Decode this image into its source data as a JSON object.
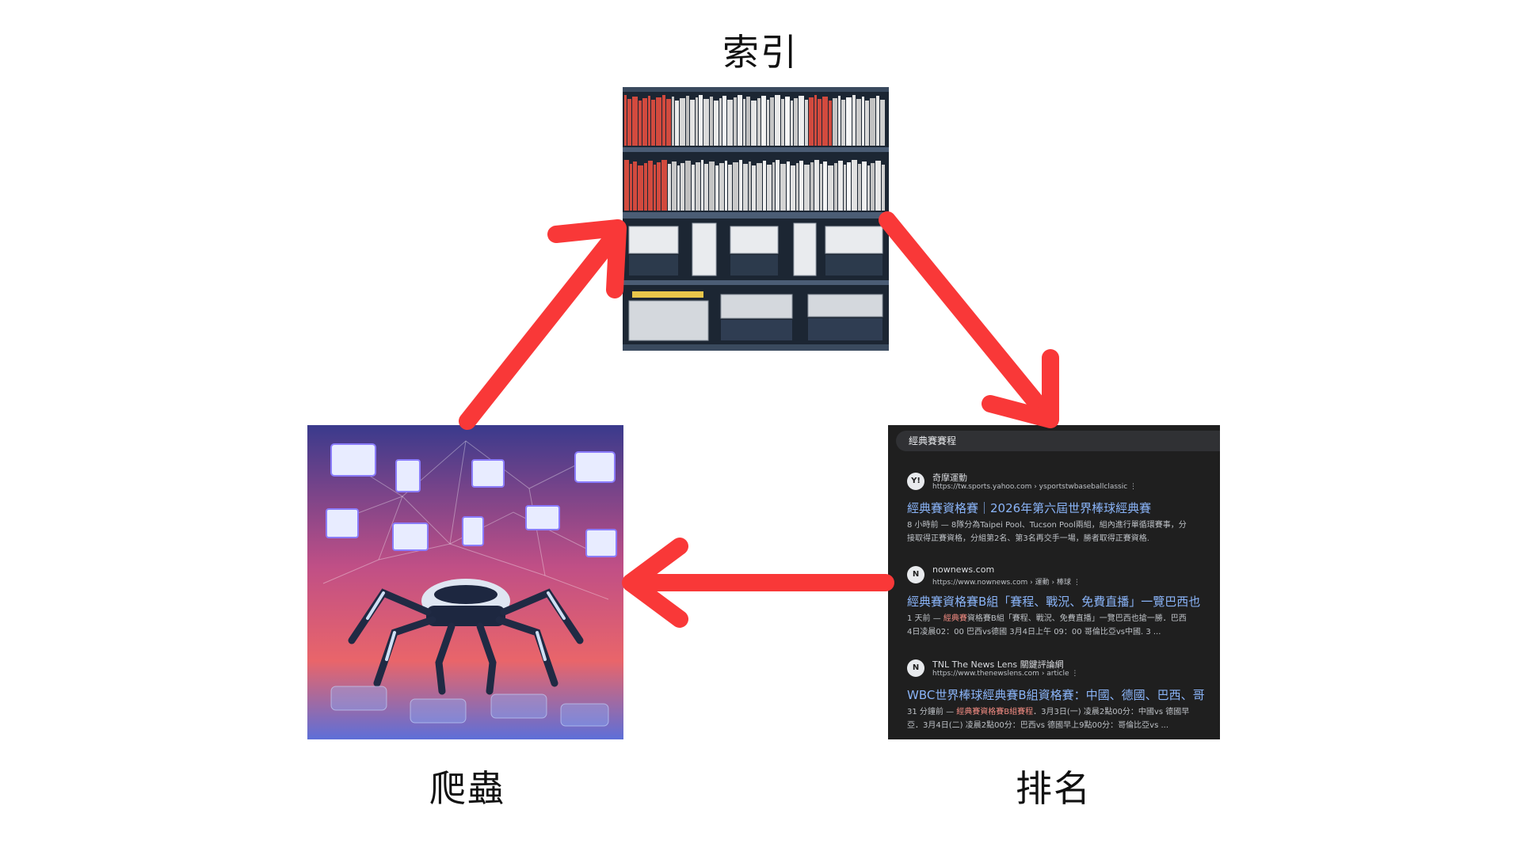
{
  "labels": {
    "index": "索引",
    "crawl": "爬蟲",
    "rank": "排名"
  },
  "colors": {
    "arrow": "#f93838",
    "background": "#ffffff"
  },
  "illustrations": {
    "index": "bookshelf-with-servers-image",
    "crawl": "robot-spider-web-pages-image"
  },
  "results": {
    "query": "經典賽賽程",
    "items": [
      {
        "site": "奇摩運動",
        "url": "https://tw.sports.yahoo.com › ysportstwbaseballclassic ⋮",
        "title": "經典賽資格賽｜2026年第六屆世界棒球經典賽",
        "snippet_prefix": "8 小時前 — ",
        "snippet_hl": "",
        "snippet": "8隊分為Taipei Pool、Tucson Pool兩組，組內進行單循環賽事，分",
        "snippet2": "接取得正賽資格，分組第2名、第3名再交手一場，勝者取得正賽資格."
      },
      {
        "site": "nownews.com",
        "url": "https://www.nownews.com › 運動 › 棒球 ⋮",
        "title": "經典賽資格賽B組「賽程、戰況、免費直播」一覽巴西也",
        "snippet_prefix": "1 天前 — ",
        "snippet_hl": "經典賽",
        "snippet": "資格賽B組「賽程、戰況、免費直播」一覽巴西也搶一勝．巴西",
        "snippet2": "4日凌晨02：00 巴西vs德國 3月4日上午 09：00 哥倫比亞vs中國. 3 ..."
      },
      {
        "site": "TNL The News Lens 關鍵評論網",
        "url": "https://www.thenewslens.com › article ⋮",
        "title": "WBC世界棒球經典賽B組資格賽：中國、德國、巴西、哥",
        "snippet_prefix": "31 分鐘前 — ",
        "snippet_hl": "經典賽資格賽B組賽程",
        "snippet": "．3月3日(一) 凌晨2點00分：中國vs 德國早",
        "snippet2": "亞．3月4日(二) 凌晨2點00分：巴西vs 德國早上9點00分：哥倫比亞vs ..."
      }
    ]
  }
}
